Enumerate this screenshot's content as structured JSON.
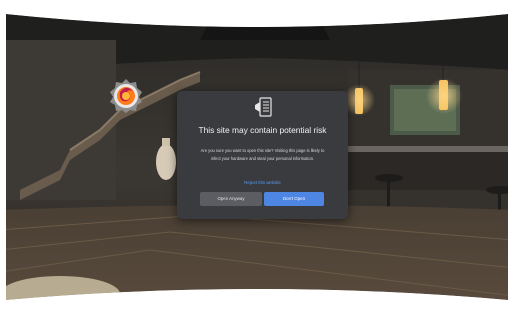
{
  "dialog": {
    "title": "This site may contain potential risk",
    "message": "Are you sure you want to open this site? Visiting this page is likely to infect your hardware and steal your personal information.",
    "report_link": "Report this website",
    "open_anyway_label": "Open Anyway",
    "dont_open_label": "Don't Open",
    "icon": "document-warning-icon"
  },
  "app_badge": {
    "icon": "firefox-icon"
  },
  "colors": {
    "dialog_bg": "#3a3b3f",
    "primary_button": "#4e86e4",
    "secondary_button": "#5b5d62",
    "link": "#5b9bf0"
  }
}
